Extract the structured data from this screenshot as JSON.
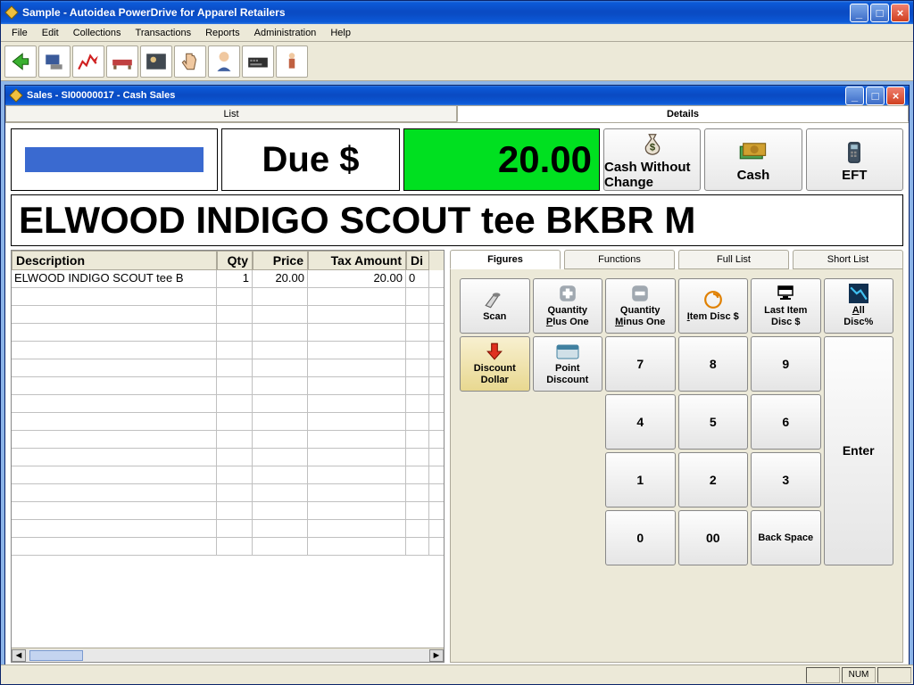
{
  "outer_window": {
    "title": "Sample - Autoidea PowerDrive for Apparel Retailers"
  },
  "menubar": [
    "File",
    "Edit",
    "Collections",
    "Transactions",
    "Reports",
    "Administration",
    "Help"
  ],
  "toolbar_icons": [
    "back",
    "terminal",
    "chart",
    "bed",
    "photo",
    "hand",
    "person",
    "keyboard",
    "figure"
  ],
  "inner_window": {
    "title": "Sales - SI00000017 - Cash Sales"
  },
  "main_tabs": {
    "list": "List",
    "details": "Details"
  },
  "due": {
    "label": "Due $",
    "amount": "20.00"
  },
  "pay_buttons": {
    "cash_no_change": "Cash Without Change",
    "cash": "Cash",
    "eft": "EFT"
  },
  "product_name": "ELWOOD INDIGO SCOUT tee BKBR M",
  "grid": {
    "headers": {
      "desc": "Description",
      "qty": "Qty",
      "price": "Price",
      "tax": "Tax Amount",
      "di": "Di"
    },
    "rows": [
      {
        "desc": "ELWOOD INDIGO SCOUT tee B",
        "qty": "1",
        "price": "20.00",
        "tax": "20.00",
        "di": "0"
      }
    ]
  },
  "right_tabs": {
    "figures": "Figures",
    "functions": "Functions",
    "full_list": "Full List",
    "short_list": "Short List"
  },
  "keypad": {
    "scan": "Scan",
    "qty_plus": "Quantity Plus One",
    "qty_minus": "Quantity Minus One",
    "item_disc": "Item Disc $",
    "last_item_disc": "Last Item Disc $",
    "all_disc": "All Disc%",
    "discount_dollar": "Discount Dollar",
    "point_discount": "Point Discount",
    "k7": "7",
    "k8": "8",
    "k9": "9",
    "k4": "4",
    "k5": "5",
    "k6": "6",
    "k1": "1",
    "k2": "2",
    "k3": "3",
    "k0": "0",
    "k00": "00",
    "backspace": "Back Space",
    "enter": "Enter"
  },
  "statusbar": {
    "num": "NUM"
  }
}
